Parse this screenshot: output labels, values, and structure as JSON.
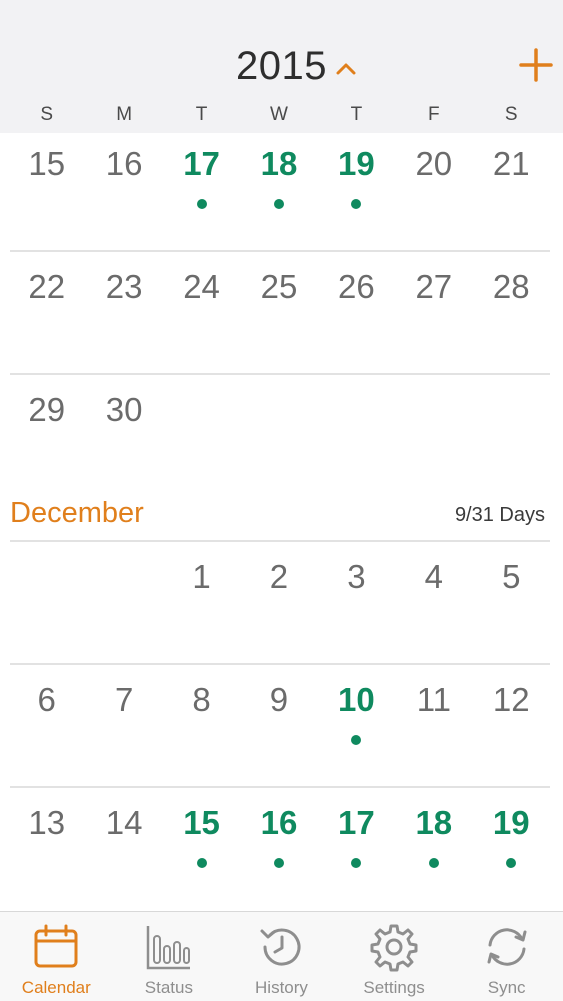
{
  "header": {
    "year": "2015"
  },
  "weekdays": [
    "S",
    "M",
    "T",
    "W",
    "T",
    "F",
    "S"
  ],
  "november": {
    "weeks": [
      [
        {
          "d": "15"
        },
        {
          "d": "16"
        },
        {
          "d": "17",
          "a": true
        },
        {
          "d": "18",
          "a": true
        },
        {
          "d": "19",
          "a": true
        },
        {
          "d": "20"
        },
        {
          "d": "21"
        }
      ],
      [
        {
          "d": "22"
        },
        {
          "d": "23"
        },
        {
          "d": "24"
        },
        {
          "d": "25"
        },
        {
          "d": "26"
        },
        {
          "d": "27"
        },
        {
          "d": "28"
        }
      ],
      [
        {
          "d": "29"
        },
        {
          "d": "30"
        },
        {
          "d": ""
        },
        {
          "d": ""
        },
        {
          "d": ""
        },
        {
          "d": ""
        },
        {
          "d": ""
        }
      ]
    ]
  },
  "december": {
    "title": "December",
    "days_count": "9/31 Days",
    "weeks": [
      [
        {
          "d": ""
        },
        {
          "d": ""
        },
        {
          "d": "1"
        },
        {
          "d": "2"
        },
        {
          "d": "3"
        },
        {
          "d": "4"
        },
        {
          "d": "5"
        }
      ],
      [
        {
          "d": "6"
        },
        {
          "d": "7"
        },
        {
          "d": "8"
        },
        {
          "d": "9"
        },
        {
          "d": "10",
          "a": true
        },
        {
          "d": "11"
        },
        {
          "d": "12"
        }
      ],
      [
        {
          "d": "13"
        },
        {
          "d": "14"
        },
        {
          "d": "15",
          "a": true
        },
        {
          "d": "16",
          "a": true
        },
        {
          "d": "17",
          "a": true
        },
        {
          "d": "18",
          "a": true
        },
        {
          "d": "19",
          "a": true
        }
      ]
    ]
  },
  "tabs": [
    {
      "label": "Calendar",
      "icon": "calendar-icon",
      "active": true
    },
    {
      "label": "Status",
      "icon": "bar-chart-icon"
    },
    {
      "label": "History",
      "icon": "history-icon"
    },
    {
      "label": "Settings",
      "icon": "gear-icon"
    },
    {
      "label": "Sync",
      "icon": "sync-icon"
    }
  ],
  "colors": {
    "accent_orange": "#e07f1c",
    "active_green": "#0f8a5f",
    "header_bg": "#f2f2f4"
  }
}
